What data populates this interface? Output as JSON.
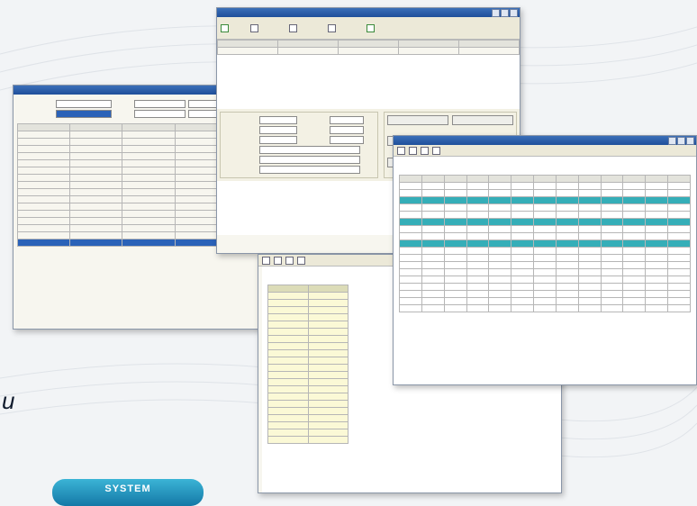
{
  "left_window": {
    "title": "",
    "fields": [
      "",
      ""
    ],
    "date_from": "",
    "date_to": "",
    "columns": [
      "",
      "",
      "",
      "",
      ""
    ],
    "rows": 16
  },
  "top_window": {
    "title": "",
    "form_title": "",
    "labels": [
      "",
      "",
      "",
      "",
      "",
      ""
    ],
    "side_labels": [
      "",
      "",
      ""
    ],
    "buttons": [
      "",
      "",
      "",
      "",
      "",
      ""
    ]
  },
  "mid_report": {
    "title": "",
    "rows": 22
  },
  "right_report": {
    "title": "",
    "columns": [
      "",
      "",
      "",
      "",
      "",
      "",
      "",
      "",
      "",
      "",
      "",
      "",
      ""
    ]
  },
  "side_glyph": "u",
  "pill_label": "SYSTEM"
}
